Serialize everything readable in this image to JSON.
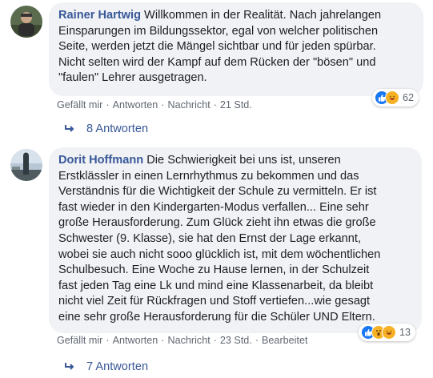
{
  "comments": [
    {
      "author": "Rainer Hartwig",
      "text": " Willkommen in der Realität. Nach jahrelangen\nEinsparungen im Bildungssektor, egal von welcher politischen\nSeite, werden jetzt die Mängel sichtbar und für jeden spürbar.\nNicht selten wird der Kampf auf dem Rücken der \"bösen\" und\n\"faulen\" Lehrer ausgetragen.",
      "like_label": "Gefällt mir",
      "reply_label": "Antworten",
      "message_label": "Nachricht",
      "time": "21 Std.",
      "edited": "",
      "reaction_count": "62",
      "reaction_icons": [
        "like-icon",
        "laugh-icon"
      ],
      "replies_label": "8 Antworten"
    },
    {
      "author": "Dorit Hoffmann",
      "text": " Die Schwierigkeit bei uns ist, unseren\nErstklässler in einen Lernrhythmus zu bekommen und das\nVerständnis für die Wichtigkeit der Schule zu vermitteln. Er ist\nfast wieder in den Kindergarten-Modus verfallen... Eine sehr\ngroße Herausforderung. Zum Glück zieht ihn etwas die große\nSchwester (9. Klasse), sie hat den Ernst der Lage erkannt,\nwobei sie auch nicht sooo glücklich ist, mit dem wöchentlichen\nSchulbesuch. Eine Woche zu Hause lernen, in der Schulzeit\nfast jeden Tag eine Lk und mind eine Klassenarbeit, da bleibt\nnicht viel Zeit für Rückfragen und Stoff vertiefen...wie gesagt\neine sehr große Herausforderung für die Schüler UND Eltern.",
      "like_label": "Gefällt mir",
      "reply_label": "Antworten",
      "message_label": "Nachricht",
      "time": "23 Std.",
      "edited": "Bearbeitet",
      "reaction_count": "13",
      "reaction_icons": [
        "like-icon",
        "wow-icon",
        "laugh-icon"
      ],
      "replies_label": "7 Antworten"
    }
  ],
  "colors": {
    "link": "#385898",
    "bubble": "#f0f2f5",
    "meta": "#606770",
    "like_blue": "#1877f2",
    "haha_yellow": "#f7b125"
  }
}
